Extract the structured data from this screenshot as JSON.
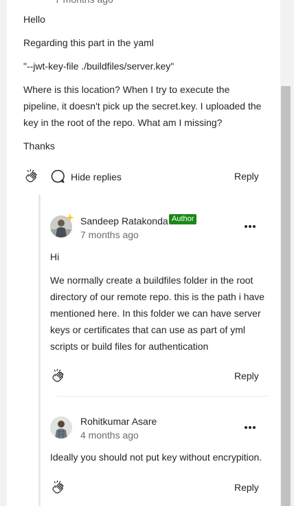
{
  "top_comment": {
    "timestamp_partial": "7 months ago",
    "paragraphs": [
      "Hello",
      "Regarding this part in the yaml",
      "\"--jwt-key-file ./buildfiles/server.key\"",
      "Where is this location? When I try to execute the pipeline, it doesn't pick up the secret.key. I uploaded the key in the root of the repo. What am I missing?",
      "Thanks"
    ],
    "hide_replies_label": "Hide replies",
    "reply_label": "Reply"
  },
  "replies": [
    {
      "author": "Sandeep Ratakonda",
      "badge": "Author",
      "time": "7 months ago",
      "paragraphs": [
        "Hi",
        "We normally create a buildfiles folder in the root directory of our remote repo. this is the path i have mentioned here. In this folder we can have server keys or certificates that can use as part of yml scripts or build files for authentication"
      ],
      "reply_label": "Reply"
    },
    {
      "author": "Rohitkumar Asare",
      "time": "4 months ago",
      "paragraphs": [
        "Ideally you should not put key without encrypition."
      ],
      "reply_label": "Reply"
    }
  ],
  "icons": {
    "clap": "clap-icon",
    "comment": "comment-bubble-icon",
    "more": "more-options-icon"
  },
  "colors": {
    "text": "#242424",
    "muted": "#6b6b6b",
    "author_badge": "#1a8917",
    "background": "#ffffff",
    "page": "#f2f2f2"
  }
}
